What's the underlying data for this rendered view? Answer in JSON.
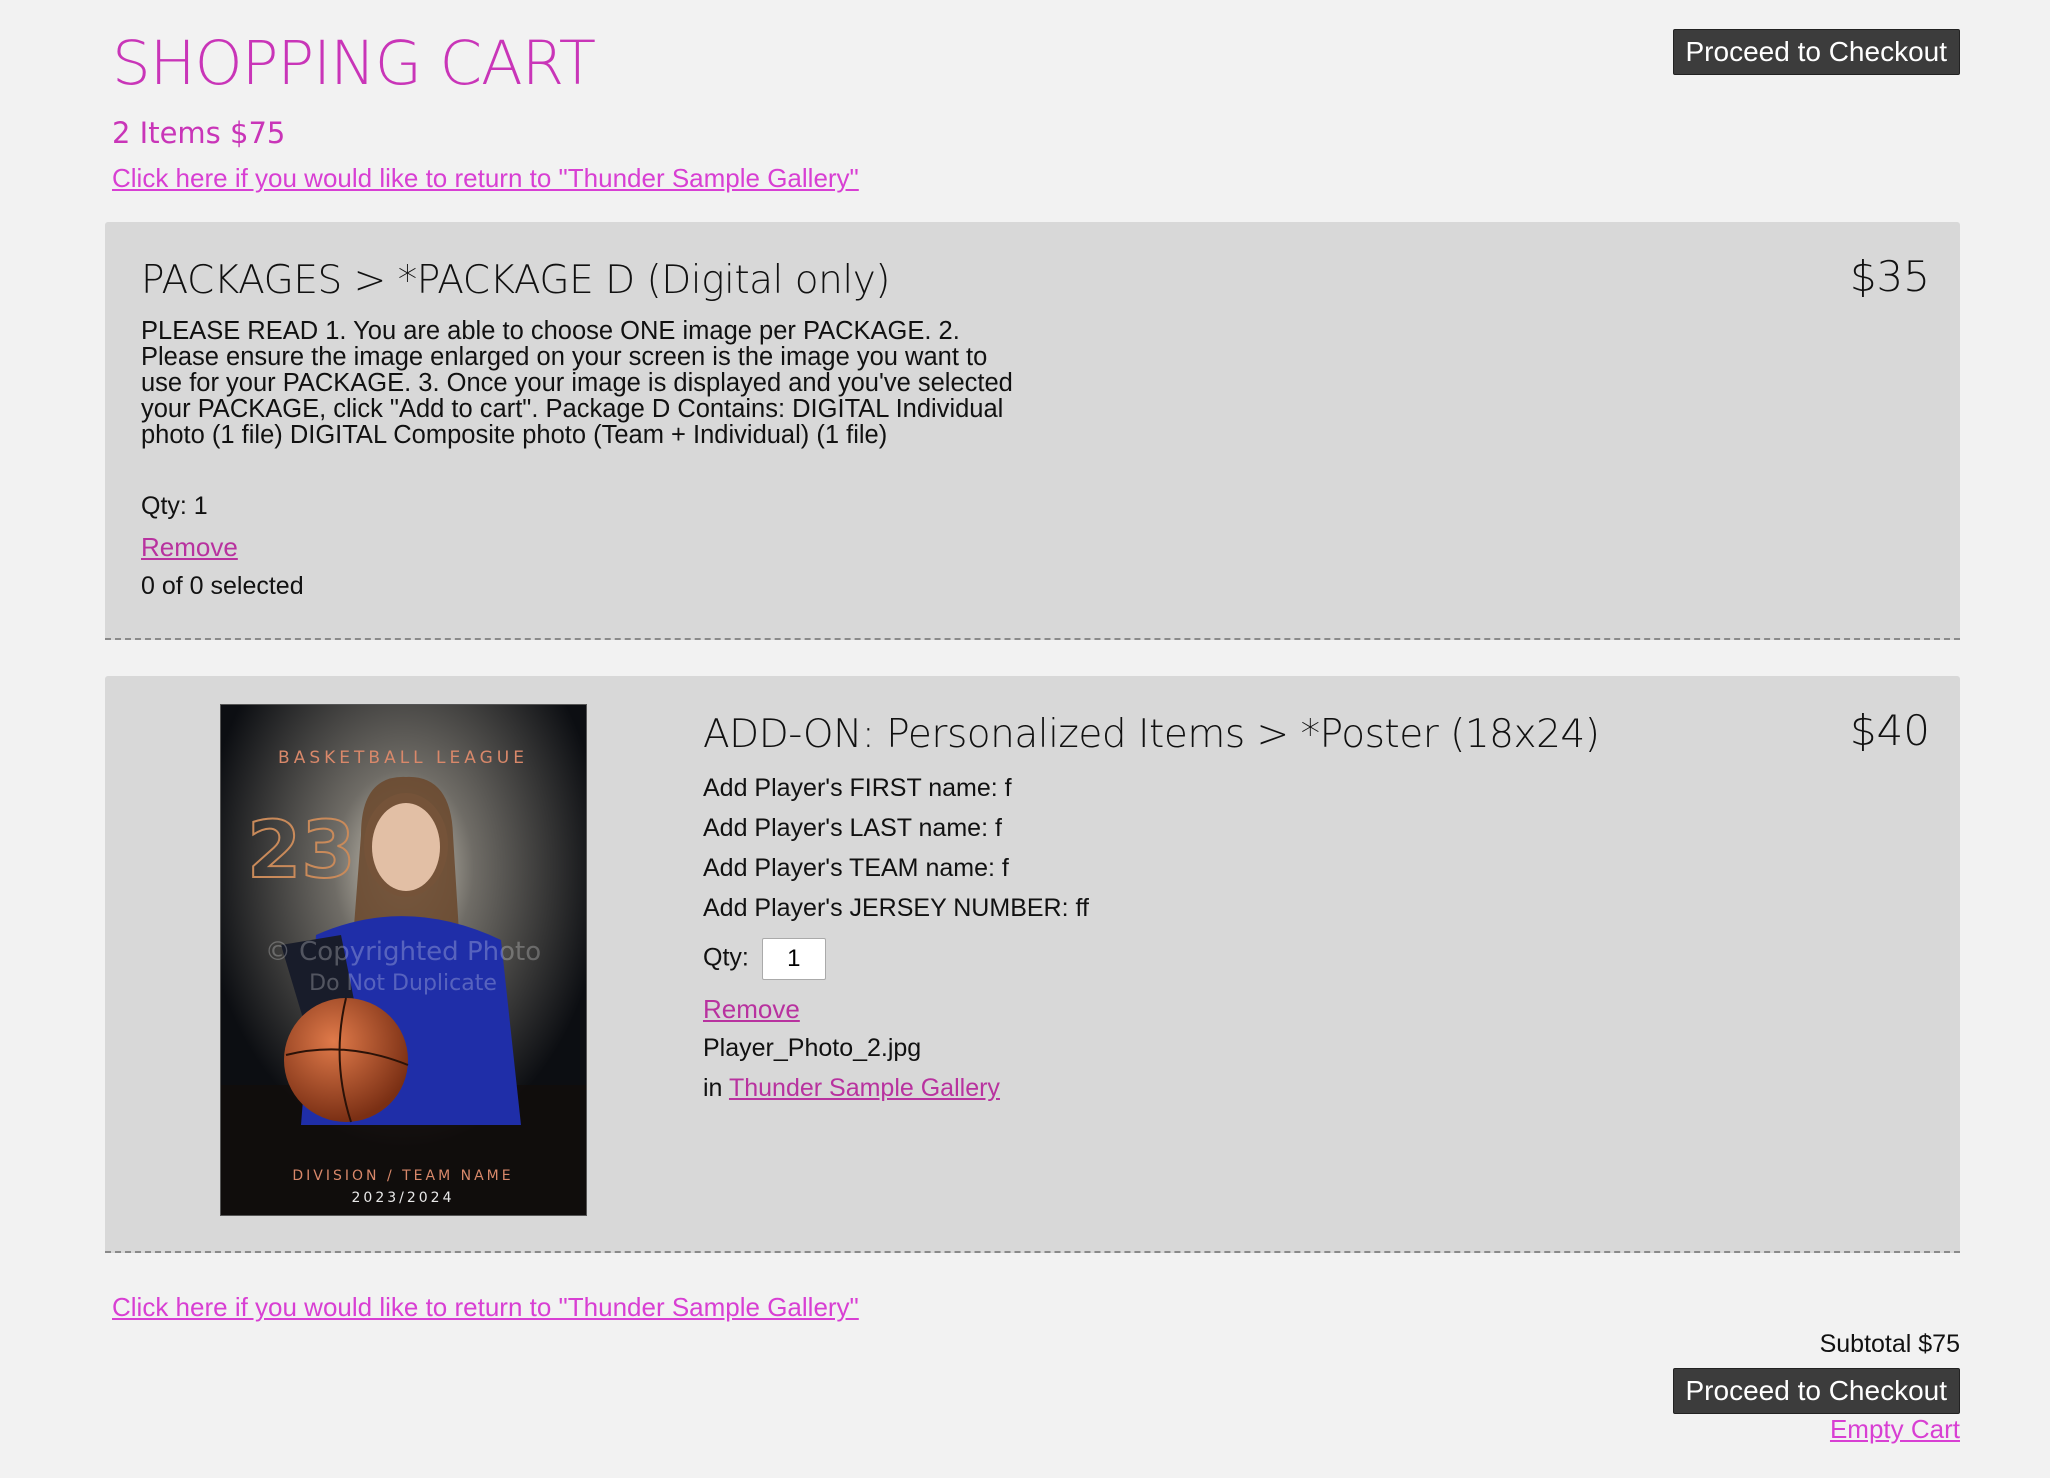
{
  "header": {
    "title": "SHOPPING CART",
    "summary": "2 Items $75",
    "return_link": "Click here if you would like to return to \"Thunder Sample Gallery\"",
    "checkout_label": "Proceed to Checkout"
  },
  "items": [
    {
      "title": "PACKAGES > *PACKAGE D (Digital only)",
      "price": "$35",
      "description": "PLEASE READ 1. You are able to choose ONE image per PACKAGE. 2. Please ensure the image enlarged on your screen is the image you want to use for your PACKAGE. 3. Once your image is displayed and you've selected your PACKAGE, click \"Add to cart\". Package D Contains: DIGITAL Individual photo (1 file) DIGITAL Composite photo (Team + Individual) (1 file)",
      "qty_text": "Qty: 1",
      "remove_label": "Remove",
      "selected_text": "0 of 0 selected"
    },
    {
      "title": "ADD-ON: Personalized Items > *Poster (18x24)",
      "price": "$40",
      "fields": [
        "Add Player's FIRST name: f",
        "Add Player's LAST name: f",
        "Add Player's TEAM name: f",
        "Add Player's JERSEY NUMBER: ff"
      ],
      "qty_label": "Qty:",
      "qty_value": "1",
      "remove_label": "Remove",
      "filename": "Player_Photo_2.jpg",
      "in_label": "in",
      "gallery_name": "Thunder Sample Gallery",
      "thumbnail": {
        "icon": "player-poster-image",
        "league_text": "BASKETBALL LEAGUE",
        "number": "23",
        "watermark_line1": "© Copyrighted Photo",
        "watermark_line2": "Do Not Duplicate",
        "division_text": "DIVISION / TEAM NAME",
        "season_text": "2023/2024"
      }
    }
  ],
  "footer": {
    "return_link": "Click here if you would like to return to \"Thunder Sample Gallery\"",
    "subtotal": "Subtotal $75",
    "checkout_label": "Proceed to Checkout",
    "empty_cart_label": "Empty Cart"
  },
  "colors": {
    "accent": "#c935b8",
    "link": "#d83fd3",
    "button_bg": "#3c3c3c",
    "page_bg": "#f2f2f2",
    "item_bg": "#d8d8d8"
  }
}
